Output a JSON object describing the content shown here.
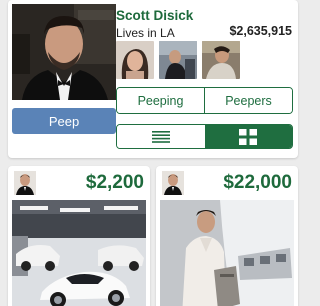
{
  "profile": {
    "name": "Scott Disick",
    "location": "Lives in LA",
    "net_worth": "$2,635,915",
    "photo_icon": "profile-photo",
    "follower_thumbnails": [
      "follower-thumb-1",
      "follower-thumb-2",
      "follower-thumb-3"
    ]
  },
  "actions": {
    "peep_label": "Peep"
  },
  "tabs": [
    {
      "label": "Peeping"
    },
    {
      "label": "Peepers"
    }
  ],
  "view_toggle": {
    "list_icon": "list-view-icon",
    "grid_icon": "grid-view-icon",
    "selected": "grid"
  },
  "posts": [
    {
      "price": "$2,200",
      "image": "showroom-cars-photo",
      "avatar": "user-avatar"
    },
    {
      "price": "$22,000",
      "image": "private-jet-photo",
      "avatar": "user-avatar"
    }
  ],
  "colors": {
    "accent_green": "#1f6e40",
    "button_blue": "#5a83b7",
    "background": "#ececec"
  }
}
